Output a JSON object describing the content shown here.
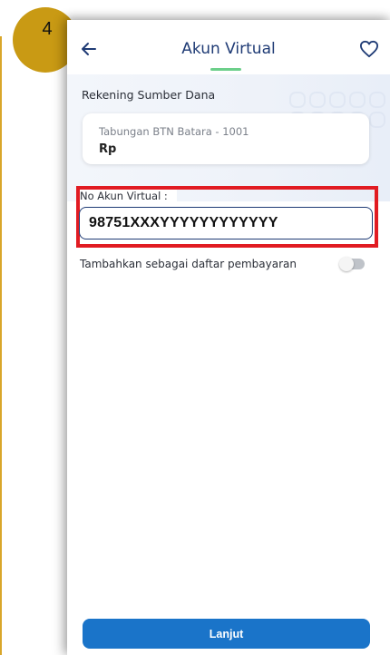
{
  "step": {
    "number": "4"
  },
  "header": {
    "title": "Akun Virtual",
    "back_icon": "arrow-left-icon",
    "favorite_icon": "heart-icon"
  },
  "source": {
    "label": "Rekening Sumber Dana",
    "account_name": "Tabungan BTN Batara - 1001",
    "balance": "Rp"
  },
  "virtual_account": {
    "label": "No Akun Virtual :",
    "value": "98751XXXYYYYYYYYYYYY"
  },
  "save_option": {
    "label": "Tambahkan sebagai daftar pembayaran",
    "enabled": false
  },
  "actions": {
    "continue_label": "Lanjut"
  },
  "colors": {
    "primary": "#1a74c9",
    "title": "#1f3b75",
    "highlight": "#e11b22",
    "badge": "#c99a14",
    "accent_green": "#6ccf8a"
  }
}
